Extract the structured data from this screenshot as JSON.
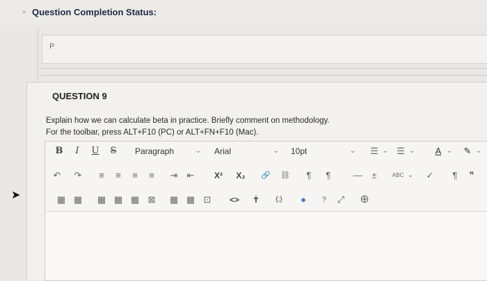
{
  "status": {
    "chevron": "»",
    "title": "Question Completion Status:"
  },
  "answer_preview": {
    "label": "P"
  },
  "question": {
    "title": "QUESTION 9",
    "prompt": "Explain how we can calculate beta in practice. Briefly comment on methodology.",
    "hint": "For the toolbar, press ALT+F10 (PC) or ALT+FN+F10 (Mac)."
  },
  "toolbar": {
    "row1": {
      "bold": "B",
      "italic": "I",
      "underline": "U",
      "strike": "S",
      "paragraph": "Paragraph",
      "font": "Arial",
      "size": "10pt",
      "caret": "⌄"
    },
    "row2": {
      "undo": "↶",
      "redo": "↷",
      "align_left": "≡",
      "align_center": "≡",
      "align_right": "≡",
      "align_justify": "≡",
      "indent": "⇥",
      "outdent": "⇤",
      "superscript": "X²",
      "subscript": "X₂",
      "link": "🔗",
      "unlink": "⛓",
      "ltr": "¶",
      "rtl": "¶",
      "hr": "—",
      "plus_minus": "±",
      "spell": "ABC",
      "check": "✓",
      "pilcrow": "¶",
      "quote": "❞",
      "text_color": "A",
      "highlight": "✎"
    },
    "row3": {
      "table": "▦",
      "table2": "▦",
      "t3": "▦",
      "t4": "▦",
      "t5": "▦",
      "t6": "⊠",
      "t7": "▦",
      "t8": "▦",
      "t9": "⊡",
      "code": "<>",
      "accessibility": "✝",
      "braces": "{;}",
      "media": "●",
      "help": "?",
      "fullscreen": "⤢",
      "add": "⊕"
    }
  }
}
